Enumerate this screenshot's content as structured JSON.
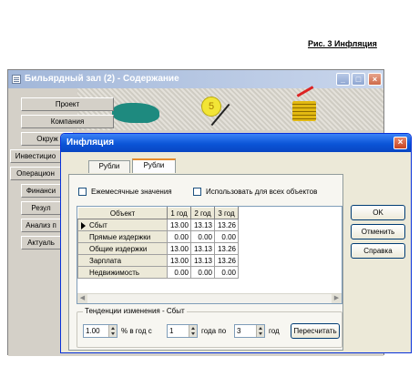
{
  "caption": "Рис. 3 Инфляция",
  "background_window": {
    "title": "Бильярдный зал (2) - Содержание",
    "controls": {
      "minimize": "_",
      "maximize": "□",
      "close": "×"
    },
    "nav": [
      "Проект",
      "Компания",
      "Окруж",
      "Инвестицио",
      "Операцион",
      "Финанси",
      "Резул",
      "Анализ п",
      "Актуаль"
    ],
    "coin_digit": "5"
  },
  "dialog": {
    "title": "Инфляция",
    "close": "×",
    "tabs": [
      {
        "label": "Рубли",
        "active": false
      },
      {
        "label": "Рубли",
        "active": true
      }
    ],
    "checkbox_monthly": "Ежемесячные значения",
    "checkbox_all_objects": "Использовать для всех объектов",
    "grid": {
      "headers": [
        "Объект",
        "1 год",
        "2 год",
        "3 год"
      ],
      "rows": [
        {
          "name": "Сбыт",
          "values": [
            "13.00",
            "13.13",
            "13.26"
          ],
          "selected": true
        },
        {
          "name": "Прямые издержки",
          "values": [
            "0.00",
            "0.00",
            "0.00"
          ]
        },
        {
          "name": "Общие издержки",
          "values": [
            "13.00",
            "13.13",
            "13.26"
          ]
        },
        {
          "name": "Зарплата",
          "values": [
            "13.00",
            "13.13",
            "13.26"
          ]
        },
        {
          "name": "Недвижимость",
          "values": [
            "0.00",
            "0.00",
            "0.00"
          ]
        }
      ]
    },
    "trend_group": {
      "label": "Тенденции изменения - Сбыт",
      "rate_value": "1.00",
      "rate_text": "% в год с",
      "from_value": "1",
      "from_text": "года по",
      "to_value": "3",
      "to_text": "год",
      "recalc_button": "Пересчитать"
    },
    "buttons": {
      "ok": "OK",
      "cancel": "Отменить",
      "help": "Справка"
    }
  },
  "colors": {
    "xp_title": "#0b55d7",
    "dialog_face": "#ece9d8",
    "classic_face": "#d4d0c8"
  }
}
